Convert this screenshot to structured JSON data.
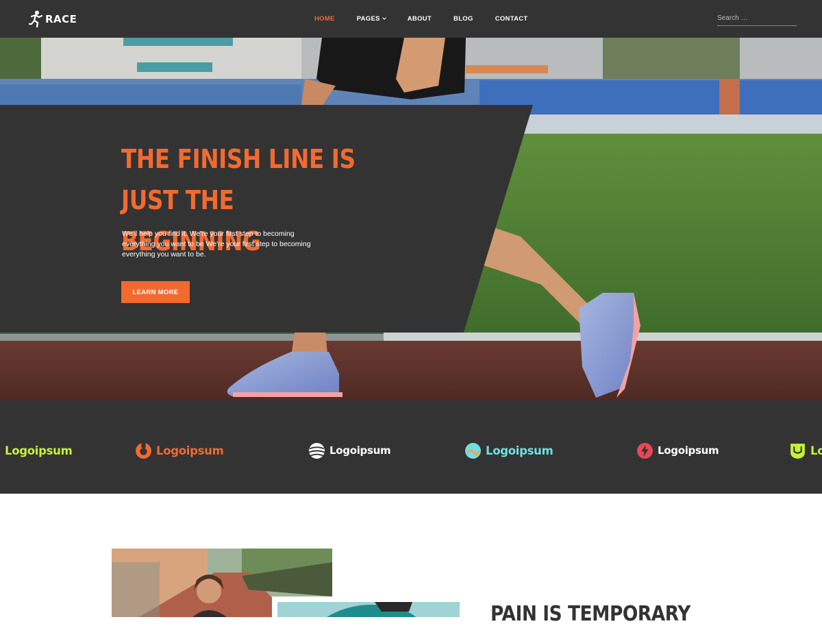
{
  "brand": {
    "name": "RACE",
    "icon": "runner-icon"
  },
  "nav": {
    "items": [
      {
        "label": "HOME",
        "active": true
      },
      {
        "label": "PAGES",
        "has_dropdown": true
      },
      {
        "label": "ABOUT"
      },
      {
        "label": "BLOG"
      },
      {
        "label": "CONTACT"
      }
    ],
    "search_placeholder": "Search …"
  },
  "hero": {
    "title": "THE FINISH LINE IS JUST THE BEGINNING",
    "text": "We'll help you find it. We're your first step to becoming everything you want to be We're your first step to becoming everything you want to be.",
    "button_label": "LEARN MORE"
  },
  "partners": [
    {
      "name": "Logoipsum",
      "icon": "lime-logo-icon",
      "color": "#c6f135"
    },
    {
      "name": "Logoipsum",
      "icon": "ring-logo-icon",
      "color": "#f26a30"
    },
    {
      "name": "Logoipsum",
      "icon": "striped-circle-logo-icon",
      "color": "#ffffff"
    },
    {
      "name": "Logoipsum",
      "icon": "gradient-circle-logo-icon",
      "color": "#6fe0e0"
    },
    {
      "name": "Logoipsum",
      "icon": "bolt-logo-icon",
      "color": "#ffffff"
    },
    {
      "name": "Lo",
      "icon": "shield-logo-icon",
      "color": "#c6f135"
    }
  ],
  "about": {
    "title": "PAIN IS TEMPORARY"
  },
  "colors": {
    "accent": "#f26a30",
    "dark": "#333333"
  }
}
